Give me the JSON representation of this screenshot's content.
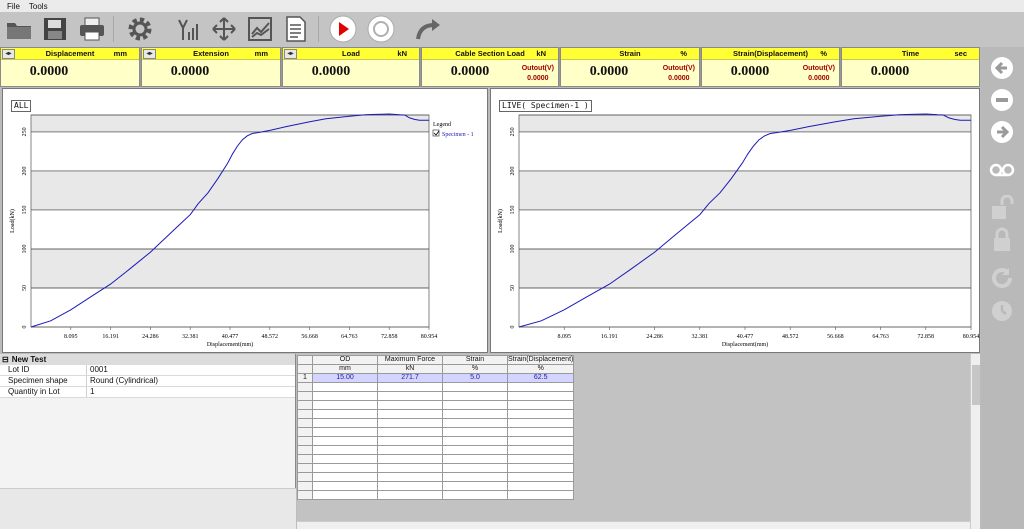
{
  "menu": [
    "File",
    "Tools"
  ],
  "toolbar_icons": [
    "open-folder-icon",
    "save-icon",
    "print-icon",
    "settings-gear-icon",
    "signal-icon",
    "move-icon",
    "chart-icon",
    "report-icon",
    "record-icon",
    "stop-icon",
    "forward-arrow-icon"
  ],
  "readouts": [
    {
      "name": "Displacement",
      "unit": "mm",
      "value": "0.0000",
      "swap": "◂▸"
    },
    {
      "name": "Extension",
      "unit": "mm",
      "value": "0.0000",
      "swap": "◂▸"
    },
    {
      "name": "Load",
      "unit": "kN",
      "value": "0.0000",
      "swap": "◂▸"
    },
    {
      "name": "Cable Section Load",
      "unit": "kN",
      "value": "0.0000",
      "sub_label": "Outout(V)",
      "sub_value": "0.0000"
    },
    {
      "name": "Strain",
      "unit": "%",
      "value": "0.0000",
      "sub_label": "Outout(V)",
      "sub_value": "0.0000"
    },
    {
      "name": "Strain(Displacement)",
      "unit": "%",
      "value": "0.0000",
      "sub_label": "Outout(V)",
      "sub_value": "0.0000"
    },
    {
      "name": "Time",
      "unit": "sec",
      "value": "0.0000"
    }
  ],
  "rail_icons": [
    "back-arrow-icon",
    "minus-icon",
    "forward-arrow-icon",
    "tape-icon",
    "unlock-icon",
    "lock-icon",
    "refresh-icon",
    "timer-icon"
  ],
  "colors": {
    "readout_head": "#ffff33",
    "readout_body": "#ffffc8",
    "curve": "#1a1ab8",
    "band": "#e8e8e8",
    "sub_text": "#a00000"
  },
  "chart_data": [
    {
      "type": "line",
      "title": "ALL",
      "xlabel": "Displacement(mm)",
      "ylabel": "Load(kN)",
      "xlim": [
        0,
        80.954
      ],
      "ylim": [
        0,
        271.7
      ],
      "xticks": [
        "8.095",
        "16.191",
        "24.286",
        "32.381",
        "40.477",
        "48.572",
        "56.668",
        "64.763",
        "72.858",
        "80.954"
      ],
      "yticks": [
        "0",
        "50",
        "100",
        "150",
        "200",
        "250"
      ],
      "legend_title": "Legend",
      "legend": "top-right",
      "series": [
        {
          "name": "Specimen - 1",
          "x": [
            0,
            4,
            8.1,
            12,
            16.2,
            20,
            24.3,
            28,
            30,
            32.4,
            34,
            36,
            38,
            40,
            41,
            42,
            43,
            44,
            45,
            46,
            48.6,
            52,
            56.7,
            60,
            64.8,
            68,
            70,
            72.9,
            74,
            75,
            76,
            77,
            78,
            79,
            80.954
          ],
          "y": [
            0,
            8,
            22,
            38,
            55,
            74,
            96,
            118,
            130,
            144,
            158,
            172,
            190,
            210,
            222,
            232,
            240,
            245,
            248,
            249,
            252,
            257,
            263,
            267,
            270,
            272,
            272.5,
            273,
            272.5,
            272,
            271.7,
            268,
            266,
            265,
            265
          ]
        }
      ]
    },
    {
      "type": "line",
      "title": "LIVE( Specimen-1 )",
      "xlabel": "Displacement(mm)",
      "ylabel": "Load(kN)",
      "xlim": [
        0,
        80.954
      ],
      "ylim": [
        0,
        271.7
      ],
      "xticks": [
        "8.095",
        "16.191",
        "24.286",
        "32.381",
        "40.477",
        "48.572",
        "56.668",
        "64.763",
        "72.858",
        "80.954"
      ],
      "yticks": [
        "0",
        "50",
        "100",
        "150",
        "200",
        "250"
      ],
      "series": [
        {
          "x": [
            0,
            4,
            8.1,
            12,
            16.2,
            20,
            24.3,
            28,
            30,
            32.4,
            34,
            36,
            38,
            40,
            41,
            42,
            43,
            44,
            45,
            46,
            48.6,
            52,
            56.7,
            60,
            64.8,
            68,
            70,
            72.9,
            74,
            75,
            76,
            77,
            78,
            79,
            80.954
          ],
          "y": [
            0,
            8,
            22,
            38,
            55,
            74,
            96,
            118,
            130,
            144,
            158,
            172,
            190,
            210,
            222,
            232,
            240,
            245,
            248,
            249,
            252,
            257,
            263,
            267,
            270,
            272,
            272.5,
            273,
            272.5,
            272,
            271.7,
            268,
            266,
            265,
            265
          ]
        }
      ]
    }
  ],
  "test": {
    "header": "New Test",
    "props": [
      {
        "label": "Lot ID",
        "value": "0001"
      },
      {
        "label": "Specimen shape",
        "value": "Round (Cylindrical)"
      },
      {
        "label": "Quantity in Lot",
        "value": "1"
      }
    ]
  },
  "results": {
    "headers": [
      "OD",
      "Maximum Force",
      "Strain",
      "Strain(Displacement)"
    ],
    "units": [
      "mm",
      "kN",
      "%",
      "%"
    ],
    "rows": [
      {
        "index": "1",
        "values": [
          "15.00",
          "271.7",
          "5.0",
          "62.5"
        ]
      }
    ]
  }
}
